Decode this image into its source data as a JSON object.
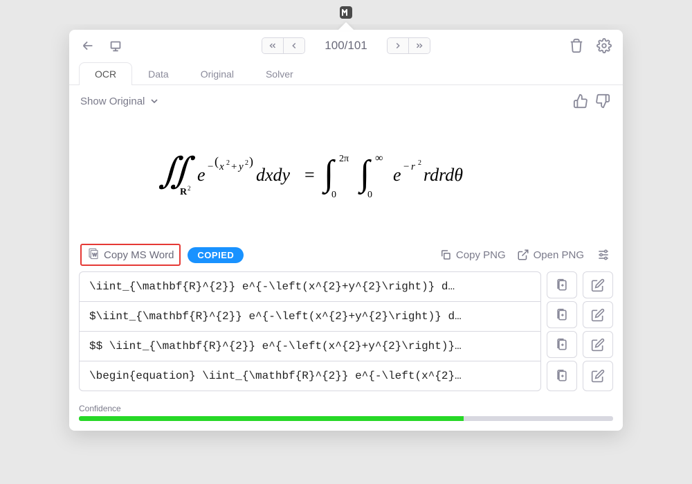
{
  "toolbar": {
    "page_indicator": "100/101"
  },
  "tabs": [
    "OCR",
    "Data",
    "Original",
    "Solver"
  ],
  "active_tab_index": 0,
  "subbar": {
    "show_original_label": "Show Original"
  },
  "equation_latex": "\\iint_{\\mathbf{R}^{2}} e^{-(x^{2}+y^{2})} dx dy = \\int_{0}^{2\\pi} \\int_{0}^{\\infty} e^{-r^{2}} r dr d\\theta",
  "actions": {
    "copy_word_label": "Copy MS Word",
    "copied_badge": "COPIED",
    "copy_png_label": "Copy PNG",
    "open_png_label": "Open PNG"
  },
  "latex_rows": [
    "\\iint_{\\mathbf{R}^{2}} e^{-\\left(x^{2}+y^{2}\\right)} d…",
    "$\\iint_{\\mathbf{R}^{2}} e^{-\\left(x^{2}+y^{2}\\right)} d…",
    "$$ \\iint_{\\mathbf{R}^{2}} e^{-\\left(x^{2}+y^{2}\\right)}…",
    "\\begin{equation} \\iint_{\\mathbf{R}^{2}} e^{-\\left(x^{2}…"
  ],
  "confidence": {
    "label": "Confidence",
    "percent": 72
  }
}
